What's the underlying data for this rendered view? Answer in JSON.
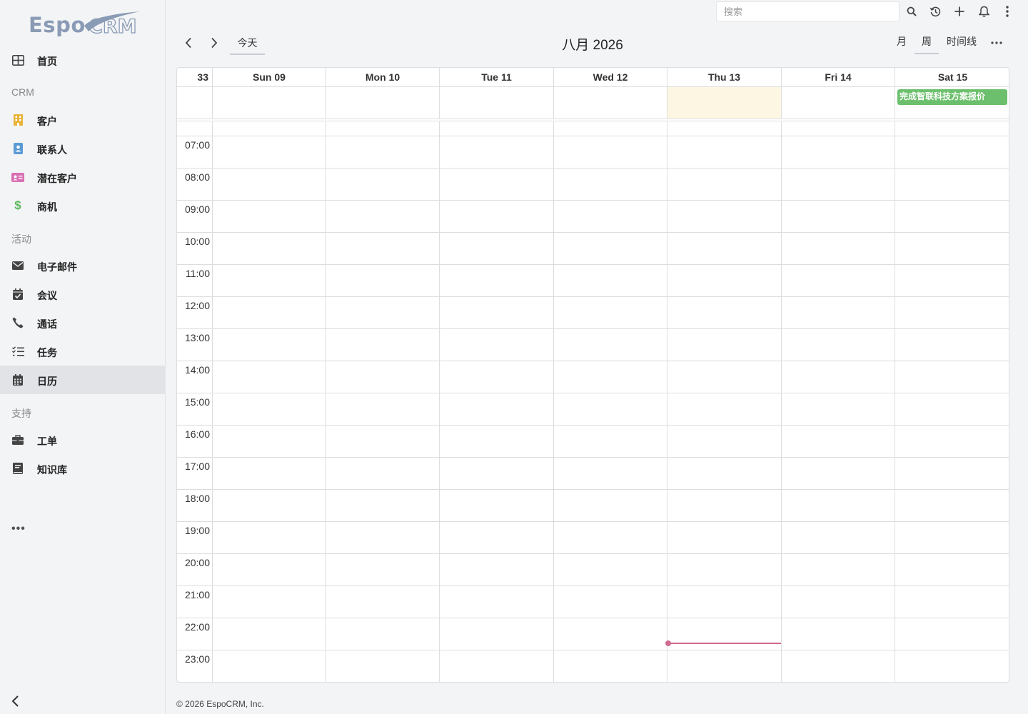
{
  "app": {
    "logo_text": "Espo",
    "logo_suffix": "CRM"
  },
  "sidebar": {
    "items": [
      {
        "label": "首页",
        "icon": "home-grid-icon"
      },
      {
        "label": "客户",
        "icon": "building-icon",
        "color": "#e8b339"
      },
      {
        "label": "联系人",
        "icon": "contact-card-icon",
        "color": "#5b9bd5"
      },
      {
        "label": "潜在客户",
        "icon": "id-card-icon",
        "color": "#d96fb2"
      },
      {
        "label": "商机",
        "icon": "dollar-icon",
        "color": "#5cb85c"
      },
      {
        "label": "电子邮件",
        "icon": "envelope-icon"
      },
      {
        "label": "会议",
        "icon": "calendar-check-icon"
      },
      {
        "label": "通话",
        "icon": "phone-icon"
      },
      {
        "label": "任务",
        "icon": "task-list-icon"
      },
      {
        "label": "日历",
        "icon": "calendar-icon"
      },
      {
        "label": "工单",
        "icon": "briefcase-icon"
      },
      {
        "label": "知识库",
        "icon": "book-icon"
      }
    ],
    "groups": [
      "CRM",
      "活动",
      "支持"
    ],
    "more": "•••"
  },
  "header": {
    "search_placeholder": "搜索"
  },
  "calendar": {
    "today_label": "今天",
    "title": "八月 2026",
    "views": [
      "月",
      "周",
      "时间线"
    ],
    "active_view": "周",
    "week_number": "33",
    "days": [
      "Sun 09",
      "Mon 10",
      "Tue 11",
      "Wed 12",
      "Thu 13",
      "Fri 14",
      "Sat 15"
    ],
    "today_day": "Thu 13",
    "hours": [
      "07:00",
      "08:00",
      "09:00",
      "10:00",
      "11:00",
      "12:00",
      "13:00",
      "14:00",
      "15:00",
      "16:00",
      "17:00",
      "18:00",
      "19:00",
      "20:00",
      "21:00",
      "22:00",
      "23:00"
    ],
    "events": [
      {
        "title": "完成智联科技方案报价",
        "day": "Sat 15",
        "all_day": true,
        "color": "#6cbf6c"
      }
    ],
    "now_indicator_color": "#d06a8f"
  },
  "footer": {
    "copyright": "© 2026 EspoCRM, Inc."
  }
}
